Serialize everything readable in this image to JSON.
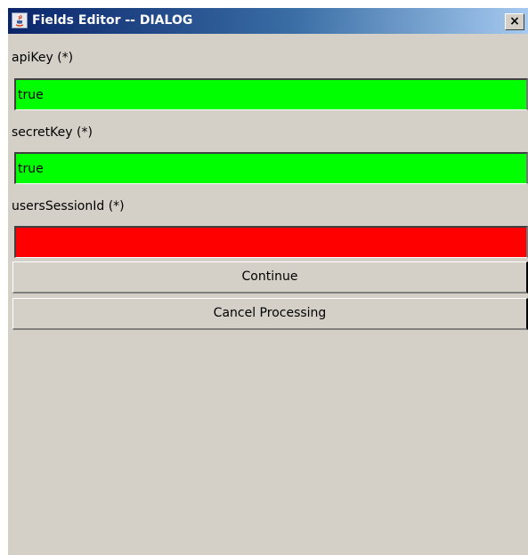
{
  "window": {
    "title": "Fields Editor -- DIALOG",
    "close_glyph": "×",
    "icon": "java-app-icon"
  },
  "fields": [
    {
      "label": "apiKey (*)",
      "value": "true",
      "status_color": "#00ff00"
    },
    {
      "label": "secretKey (*)",
      "value": "true",
      "status_color": "#00ff00"
    },
    {
      "label": "usersSessionId (*)",
      "value": "",
      "status_color": "#ff0000"
    }
  ],
  "buttons": {
    "continue_label": "Continue",
    "cancel_label": "Cancel Processing"
  }
}
